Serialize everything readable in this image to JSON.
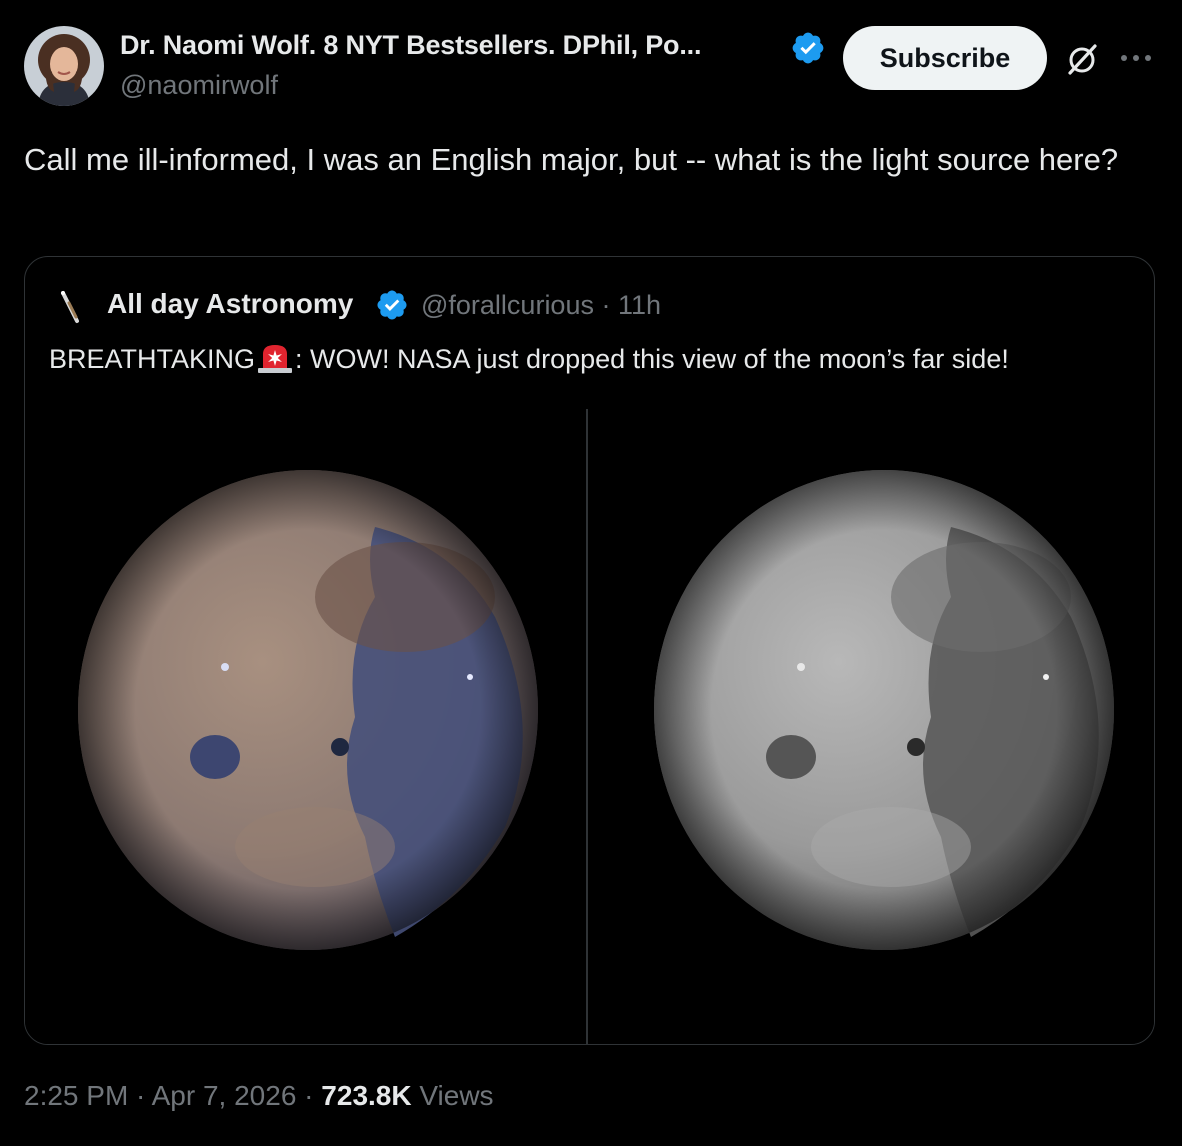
{
  "author": {
    "display_name": "Dr. Naomi Wolf. 8 NYT Bestsellers. DPhil, Po...",
    "handle": "@naomirwolf",
    "verified_color": "#1d9bf0"
  },
  "header": {
    "subscribe_label": "Subscribe",
    "grok_icon": "grok-icon",
    "more_icon": "more-icon"
  },
  "tweet": {
    "text": "Call me ill-informed, I was an English major, but -- what is the light source here?"
  },
  "quote": {
    "name": "All day Astronomy",
    "handle": "@forallcurious",
    "separator": " · ",
    "time": "11h",
    "text_before": "BREATHTAKING",
    "text_after": ": WOW! NASA just dropped this view of the moon’s far side!",
    "emoji": "rotating-light-emoji",
    "images": [
      {
        "name": "moon-color-image"
      },
      {
        "name": "moon-grayscale-image"
      }
    ]
  },
  "footer": {
    "time": "2:25 PM",
    "sep1": " · ",
    "date": "Apr 7, 2026",
    "sep2": " · ",
    "views_count": "723.8K",
    "views_label": " Views"
  }
}
